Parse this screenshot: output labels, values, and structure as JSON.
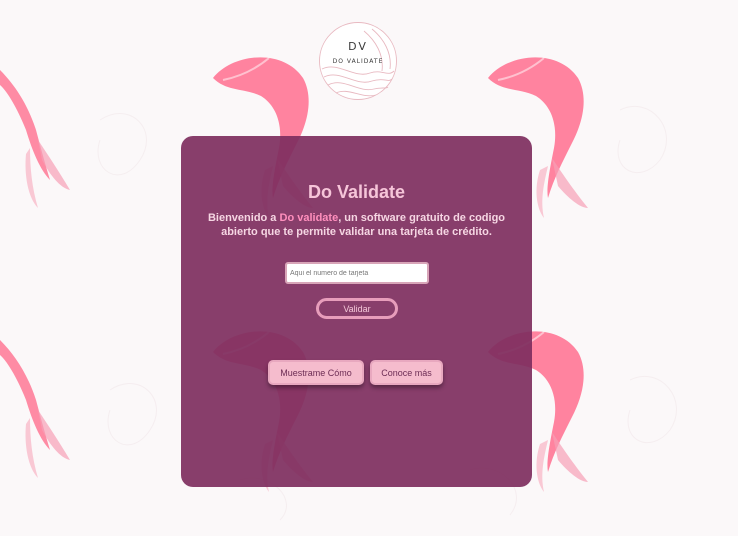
{
  "logo": {
    "initials": "DV",
    "name": "DO VALIDATE"
  },
  "card": {
    "title": "Do Validate",
    "description": {
      "prefix": "Bienvenido a ",
      "highlight": "Do validate",
      "suffix": ", un software gratuito de codigo abierto que te permite validar una tarjeta de crédito."
    },
    "input_placeholder": "Aqui el numero de tarjeta",
    "validate_label": "Validar",
    "show_me_label": "Muestrame Cómo",
    "learn_more_label": "Conoce más"
  },
  "colors": {
    "card_background": "#7e2e5e",
    "accent_pink": "#ff8fbd",
    "button_pink": "#f5bccd",
    "title_pink": "#f6c5d9",
    "fish_pink": "#ff6f8f"
  }
}
